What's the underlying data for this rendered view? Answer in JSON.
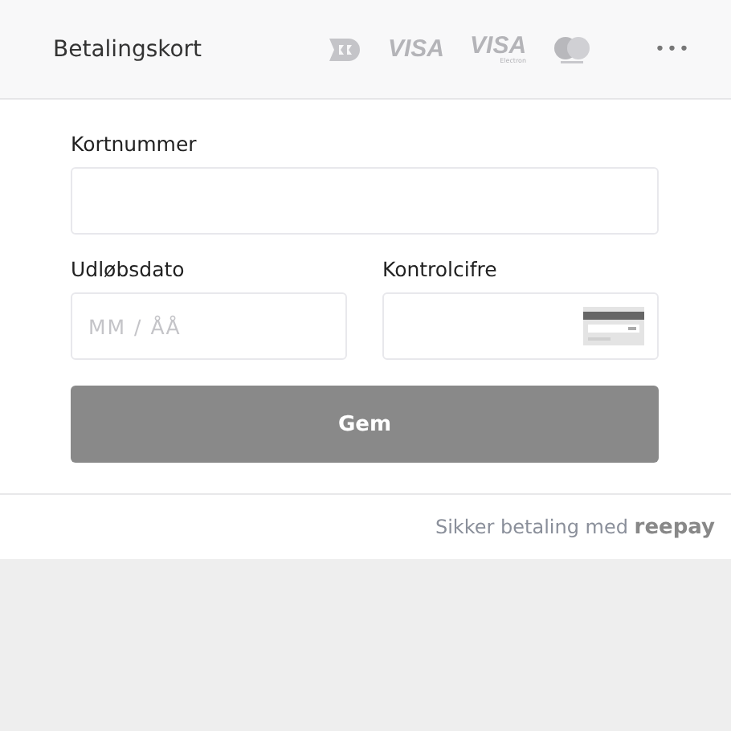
{
  "header": {
    "title": "Betalingskort",
    "brands": [
      {
        "kind": "dankort"
      },
      {
        "kind": "visa",
        "label": "VISA"
      },
      {
        "kind": "visa-electron",
        "label": "VISA",
        "sublabel": "Electron"
      },
      {
        "kind": "mastercard"
      }
    ],
    "menu": "•••"
  },
  "form": {
    "card_number": {
      "label": "Kortnummer"
    },
    "expiry": {
      "label": "Udløbsdato",
      "placeholder": "MM / ÅÅ"
    },
    "cvc": {
      "label": "Kontrolcifre"
    },
    "submit": "Gem"
  },
  "footer": {
    "text": "Sikker betaling med **reepay**"
  }
}
